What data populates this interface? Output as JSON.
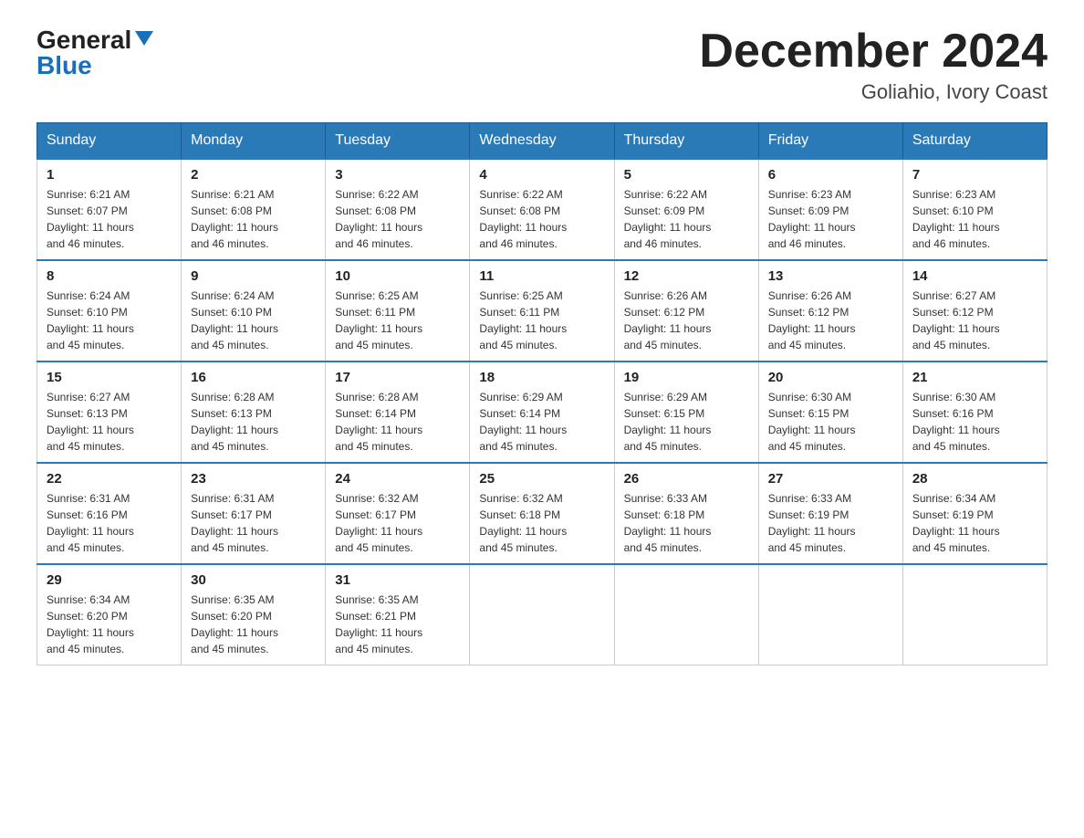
{
  "logo": {
    "general": "General",
    "blue": "Blue"
  },
  "title": {
    "month_year": "December 2024",
    "location": "Goliahio, Ivory Coast"
  },
  "weekdays": [
    "Sunday",
    "Monday",
    "Tuesday",
    "Wednesday",
    "Thursday",
    "Friday",
    "Saturday"
  ],
  "weeks": [
    [
      {
        "day": "1",
        "sunrise": "6:21 AM",
        "sunset": "6:07 PM",
        "daylight": "11 hours and 46 minutes."
      },
      {
        "day": "2",
        "sunrise": "6:21 AM",
        "sunset": "6:08 PM",
        "daylight": "11 hours and 46 minutes."
      },
      {
        "day": "3",
        "sunrise": "6:22 AM",
        "sunset": "6:08 PM",
        "daylight": "11 hours and 46 minutes."
      },
      {
        "day": "4",
        "sunrise": "6:22 AM",
        "sunset": "6:08 PM",
        "daylight": "11 hours and 46 minutes."
      },
      {
        "day": "5",
        "sunrise": "6:22 AM",
        "sunset": "6:09 PM",
        "daylight": "11 hours and 46 minutes."
      },
      {
        "day": "6",
        "sunrise": "6:23 AM",
        "sunset": "6:09 PM",
        "daylight": "11 hours and 46 minutes."
      },
      {
        "day": "7",
        "sunrise": "6:23 AM",
        "sunset": "6:10 PM",
        "daylight": "11 hours and 46 minutes."
      }
    ],
    [
      {
        "day": "8",
        "sunrise": "6:24 AM",
        "sunset": "6:10 PM",
        "daylight": "11 hours and 45 minutes."
      },
      {
        "day": "9",
        "sunrise": "6:24 AM",
        "sunset": "6:10 PM",
        "daylight": "11 hours and 45 minutes."
      },
      {
        "day": "10",
        "sunrise": "6:25 AM",
        "sunset": "6:11 PM",
        "daylight": "11 hours and 45 minutes."
      },
      {
        "day": "11",
        "sunrise": "6:25 AM",
        "sunset": "6:11 PM",
        "daylight": "11 hours and 45 minutes."
      },
      {
        "day": "12",
        "sunrise": "6:26 AM",
        "sunset": "6:12 PM",
        "daylight": "11 hours and 45 minutes."
      },
      {
        "day": "13",
        "sunrise": "6:26 AM",
        "sunset": "6:12 PM",
        "daylight": "11 hours and 45 minutes."
      },
      {
        "day": "14",
        "sunrise": "6:27 AM",
        "sunset": "6:12 PM",
        "daylight": "11 hours and 45 minutes."
      }
    ],
    [
      {
        "day": "15",
        "sunrise": "6:27 AM",
        "sunset": "6:13 PM",
        "daylight": "11 hours and 45 minutes."
      },
      {
        "day": "16",
        "sunrise": "6:28 AM",
        "sunset": "6:13 PM",
        "daylight": "11 hours and 45 minutes."
      },
      {
        "day": "17",
        "sunrise": "6:28 AM",
        "sunset": "6:14 PM",
        "daylight": "11 hours and 45 minutes."
      },
      {
        "day": "18",
        "sunrise": "6:29 AM",
        "sunset": "6:14 PM",
        "daylight": "11 hours and 45 minutes."
      },
      {
        "day": "19",
        "sunrise": "6:29 AM",
        "sunset": "6:15 PM",
        "daylight": "11 hours and 45 minutes."
      },
      {
        "day": "20",
        "sunrise": "6:30 AM",
        "sunset": "6:15 PM",
        "daylight": "11 hours and 45 minutes."
      },
      {
        "day": "21",
        "sunrise": "6:30 AM",
        "sunset": "6:16 PM",
        "daylight": "11 hours and 45 minutes."
      }
    ],
    [
      {
        "day": "22",
        "sunrise": "6:31 AM",
        "sunset": "6:16 PM",
        "daylight": "11 hours and 45 minutes."
      },
      {
        "day": "23",
        "sunrise": "6:31 AM",
        "sunset": "6:17 PM",
        "daylight": "11 hours and 45 minutes."
      },
      {
        "day": "24",
        "sunrise": "6:32 AM",
        "sunset": "6:17 PM",
        "daylight": "11 hours and 45 minutes."
      },
      {
        "day": "25",
        "sunrise": "6:32 AM",
        "sunset": "6:18 PM",
        "daylight": "11 hours and 45 minutes."
      },
      {
        "day": "26",
        "sunrise": "6:33 AM",
        "sunset": "6:18 PM",
        "daylight": "11 hours and 45 minutes."
      },
      {
        "day": "27",
        "sunrise": "6:33 AM",
        "sunset": "6:19 PM",
        "daylight": "11 hours and 45 minutes."
      },
      {
        "day": "28",
        "sunrise": "6:34 AM",
        "sunset": "6:19 PM",
        "daylight": "11 hours and 45 minutes."
      }
    ],
    [
      {
        "day": "29",
        "sunrise": "6:34 AM",
        "sunset": "6:20 PM",
        "daylight": "11 hours and 45 minutes."
      },
      {
        "day": "30",
        "sunrise": "6:35 AM",
        "sunset": "6:20 PM",
        "daylight": "11 hours and 45 minutes."
      },
      {
        "day": "31",
        "sunrise": "6:35 AM",
        "sunset": "6:21 PM",
        "daylight": "11 hours and 45 minutes."
      },
      null,
      null,
      null,
      null
    ]
  ],
  "labels": {
    "sunrise": "Sunrise:",
    "sunset": "Sunset:",
    "daylight": "Daylight:"
  },
  "colors": {
    "header_bg": "#2a7ab8",
    "header_text": "#ffffff",
    "border_blue": "#2a7ab8",
    "logo_blue": "#1a6fba"
  }
}
